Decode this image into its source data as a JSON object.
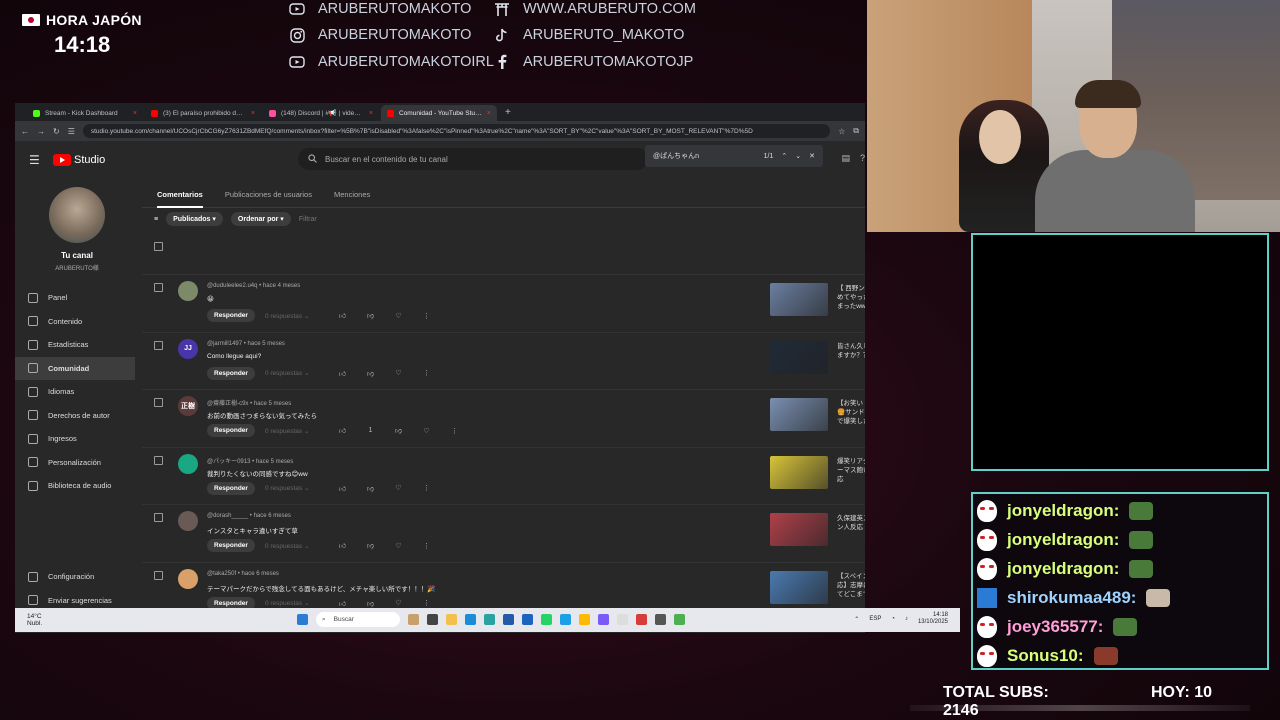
{
  "overlay": {
    "clock_label": "HORA JAPÓN",
    "clock_time": "14:18",
    "socials": [
      {
        "icon": "youtube-icon",
        "text": "ARUBERUTOMAKOTO"
      },
      {
        "icon": "instagram-icon",
        "text": "ARUBERUTOMAKOTO"
      },
      {
        "icon": "youtube-icon",
        "text": "ARUBERUTOMAKOTOIRL"
      },
      {
        "icon": "torii-icon",
        "text": "WWW.ARUBERUTO.COM"
      },
      {
        "icon": "tiktok-icon",
        "text": "ARUBERUTO_MAKOTO"
      },
      {
        "icon": "facebook-icon",
        "text": "ARUBERUTOMAKOTOJP"
      }
    ],
    "total_subs_label": "TOTAL SUBS:",
    "total_subs_value": "2146",
    "hoy_label": "HOY: 10"
  },
  "browser": {
    "tabs": [
      {
        "title": "Stream - Kick Dashboard",
        "color": "#53fc18"
      },
      {
        "title": "(3) El paraíso prohibido de las",
        "color": "#ff0000"
      },
      {
        "title": "(148) Discord | #📢 | video-re",
        "color": "#ff4fa0"
      },
      {
        "title": "Comunidad - YouTube Studio",
        "color": "#ff0000"
      }
    ],
    "new_tab": "+",
    "url": "studio.youtube.com/channel/UCOsCjrCbCG6yZ7631ZBdMEfQ/comments/inbox?filter=%5B%7B\"isDisabled\"%3Afalse%2C\"isPinned\"%3Atrue%2C\"name\"%3A\"SORT_BY\"%2C\"value\"%3A\"SORT_BY_MOST_RELEVANT\"%7D%5D"
  },
  "studio": {
    "brand": "Studio",
    "search_placeholder": "Buscar en el contenido de tu canal",
    "find_query": "@ぱんちゃんn",
    "find_count": "1/1",
    "channel_title": "Tu canal",
    "channel_handle": "ARUBERUTO様",
    "nav": [
      {
        "label": "Panel",
        "icon": "dashboard-icon"
      },
      {
        "label": "Contenido",
        "icon": "content-icon"
      },
      {
        "label": "Estadísticas",
        "icon": "analytics-icon"
      },
      {
        "label": "Comunidad",
        "icon": "community-icon"
      },
      {
        "label": "Idiomas",
        "icon": "languages-icon"
      },
      {
        "label": "Derechos de autor",
        "icon": "copyright-icon"
      },
      {
        "label": "Ingresos",
        "icon": "earn-icon"
      },
      {
        "label": "Personalización",
        "icon": "customization-icon"
      },
      {
        "label": "Biblioteca de audio",
        "icon": "audio-library-icon"
      }
    ],
    "nav_bottom": [
      {
        "label": "Configuración",
        "icon": "settings-icon"
      },
      {
        "label": "Enviar sugerencias",
        "icon": "feedback-icon"
      }
    ],
    "tabs": [
      "Comentarios",
      "Publicaciones de usuarios",
      "Menciones"
    ],
    "filter_published": "Publicados ▾",
    "filter_sort": "Ordenar por ▾",
    "filter_placeholder": "Filtrar",
    "reply_label": "Responder",
    "comments": [
      {
        "author": "@duduleelee2.u4q",
        "time": "hace 4 meses",
        "text": "😀",
        "replies": "0 respuestas",
        "likes": "",
        "avatar_color": "#7d8a6a",
        "avatar_text": "",
        "thumb_color": "#6b7fa0",
        "video_title": "【 西野ン会議 】外国人が初めてやったら… 信じ込んでしまったwww"
      },
      {
        "author": "@jarmill1497",
        "time": "hace 5 meses",
        "text": "Como llegue aqui?",
        "replies": "0 respuestas",
        "likes": "",
        "avatar_color": "#4a35a8",
        "avatar_text": "JJ",
        "thumb_color": "#1f2a38",
        "video_title": "皆さん久しぶり！まだ生きてますか？？"
      },
      {
        "author": "@齋藤正樹-c9x",
        "time": "hace 5 meses",
        "text": "お前の動画さつまらない気ってみたら",
        "replies": "0 respuestas",
        "likes": "1",
        "avatar_color": "#5a3a3a",
        "avatar_text": "正樹",
        "thumb_color": "#7a8fb0",
        "video_title": "【お笑い コント 海外の反応】🍔サンドウィッチマンの漫才で爆笑した外国人"
      },
      {
        "author": "@パッキー0913",
        "time": "hace 5 meses",
        "text": "裁判りたくないの同感ですね😊ww",
        "replies": "0 respuestas",
        "likes": "",
        "avatar_color": "#1aa784",
        "avatar_text": "",
        "thumb_color": "#d7c43a",
        "video_title": "爆笑リアクション😂こんなトーマス飽い！！👍外国人の反応"
      },
      {
        "author": "@dorash_____",
        "time": "hace 6 meses",
        "text": "インスタとキャラ違いすぎて草",
        "replies": "0 respuestas",
        "likes": "",
        "avatar_color": "#6a5a55",
        "avatar_text": "",
        "thumb_color": "#b0404a",
        "video_title": "久保建英スペイン語ｘスペイン人反応"
      },
      {
        "author": "@taka250f",
        "time": "hace 6 meses",
        "text": "テーマパークだからで残念してる面もあるけど、メチャ楽しい所です！！！🎉",
        "replies": "0 respuestas",
        "likes": "",
        "avatar_color": "#d9a06a",
        "avatar_text": "",
        "thumb_color": "#4a7ab0",
        "video_title": "【スペイン村ｘスペイン人反応】志摩にあるスペイン村ってどこまでスペインっぽ..."
      }
    ]
  },
  "taskbar": {
    "weather_temp": "14°C",
    "weather_desc": "Nubl.",
    "search_label": "Buscar",
    "lang": "ESP",
    "time": "14:18",
    "date": "13/10/2025"
  },
  "chat": [
    {
      "user": "jonyeldragon:",
      "badge": "kitsune-mask-icon",
      "emote": "#4a7a3a",
      "color": "green"
    },
    {
      "user": "jonyeldragon:",
      "badge": "kitsune-mask-icon",
      "emote": "#4a7a3a",
      "color": "green"
    },
    {
      "user": "jonyeldragon:",
      "badge": "kitsune-mask-icon",
      "emote": "#4a7a3a",
      "color": "green"
    },
    {
      "user": "shirokumaa489:",
      "badge": "sword-icon",
      "emote": "#c9b9a9",
      "color": "blue"
    },
    {
      "user": "joey365577:",
      "badge": "kitsune-mask-icon",
      "emote": "#4a7a3a",
      "color": "pink"
    },
    {
      "user": "Sonus10:",
      "badge": "kitsune-mask-icon",
      "emote": "#8a3a2a",
      "color": "green"
    }
  ]
}
